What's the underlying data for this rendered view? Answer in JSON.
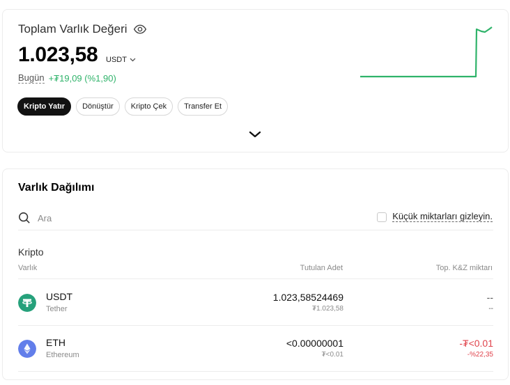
{
  "summary": {
    "title": "Toplam Varlık Değeri",
    "total_value": "1.023,58",
    "currency": "USDT",
    "today_label": "Bugün",
    "today_change": "+₮19,09 (%1,90)",
    "actions": [
      "Kripto Yatır",
      "Dönüştür",
      "Kripto Çek",
      "Transfer Et"
    ],
    "chart_color": "#2fb36a"
  },
  "distribution": {
    "title": "Varlık Dağılımı",
    "search_placeholder": "Ara",
    "hide_small_label": "Küçük miktarları gizleyin.",
    "section_label": "Kripto",
    "columns": [
      "Varlık",
      "Tutulan Adet",
      "Top. K&Z miktarı"
    ],
    "rows": [
      {
        "symbol": "USDT",
        "name": "Tether",
        "amount": "1.023,58524469",
        "amount_value": "₮1.023,58",
        "pnl": "--",
        "pnl_pct": "--",
        "icon": "tether-icon",
        "icon_color": "#26a17b"
      },
      {
        "symbol": "ETH",
        "name": "Ethereum",
        "amount": "<0.00000001",
        "amount_value": "₮<0.01",
        "pnl": "-₮<0.01",
        "pnl_pct": "-%22,35",
        "icon": "ethereum-icon",
        "icon_color": "#627eea"
      }
    ]
  }
}
